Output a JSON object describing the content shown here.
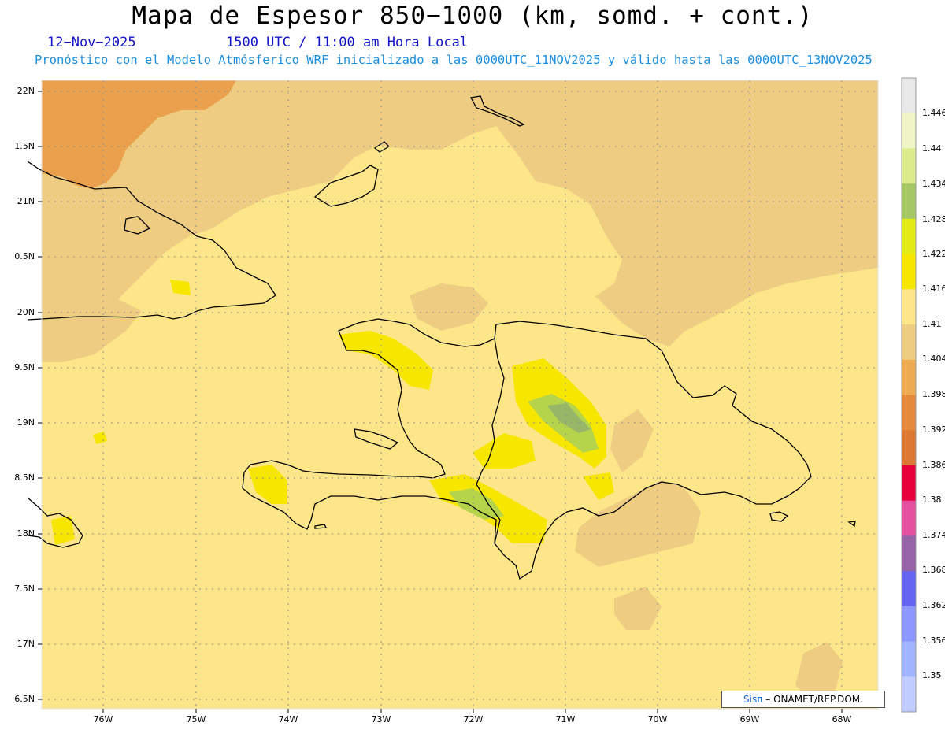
{
  "title": "Mapa de Espesor 850−1000 (km, somd. + cont.)",
  "date": "12−Nov−2025",
  "time_info": "1500 UTC / 11:00 am Hora Local",
  "forecast_info": "Pronóstico con el Modelo Atmósferico WRF inicializado a las 0000UTC_11NOV2025 y válido hasta las  0000UTC_13NOV2025",
  "lat_labels": [
    "22N",
    "1.5N",
    "21N",
    "0.5N",
    "20N",
    "9.5N",
    "19N",
    "8.5N",
    "18N",
    "7.5N",
    "17N",
    "6.5N"
  ],
  "lon_labels": [
    "76W",
    "75W",
    "74W",
    "73W",
    "72W",
    "71W",
    "70W",
    "69W",
    "68W"
  ],
  "colorbar": {
    "labels": [
      "1.446",
      "1.44",
      "1.434",
      "1.428",
      "1.422",
      "1.416",
      "1.41",
      "1.404",
      "1.398",
      "1.392",
      "1.386",
      "1.38",
      "1.374",
      "1.368",
      "1.362",
      "1.356",
      "1.35"
    ],
    "colors": [
      "#e8e8e8",
      "#f0f5c8",
      "#dceb8c",
      "#a6c864",
      "#e2ec14",
      "#f7e600",
      "#fde68a",
      "#eecd82",
      "#eeaa50",
      "#e48a3c",
      "#dc7833",
      "#e8003c",
      "#e650a0",
      "#9664a6",
      "#6464f0",
      "#8c96ff",
      "#a0b4ff",
      "#c0ccff"
    ]
  },
  "credit": {
    "brand": "Sisπ",
    "text": "– ONAMET/REP.DOM."
  },
  "map_colors": {
    "ocean": "#fde68a",
    "high": "#eecd82",
    "orange": "#eba04d",
    "yellow": "#f7e600",
    "green": "#b6d34c",
    "dgreen": "#98b668"
  }
}
